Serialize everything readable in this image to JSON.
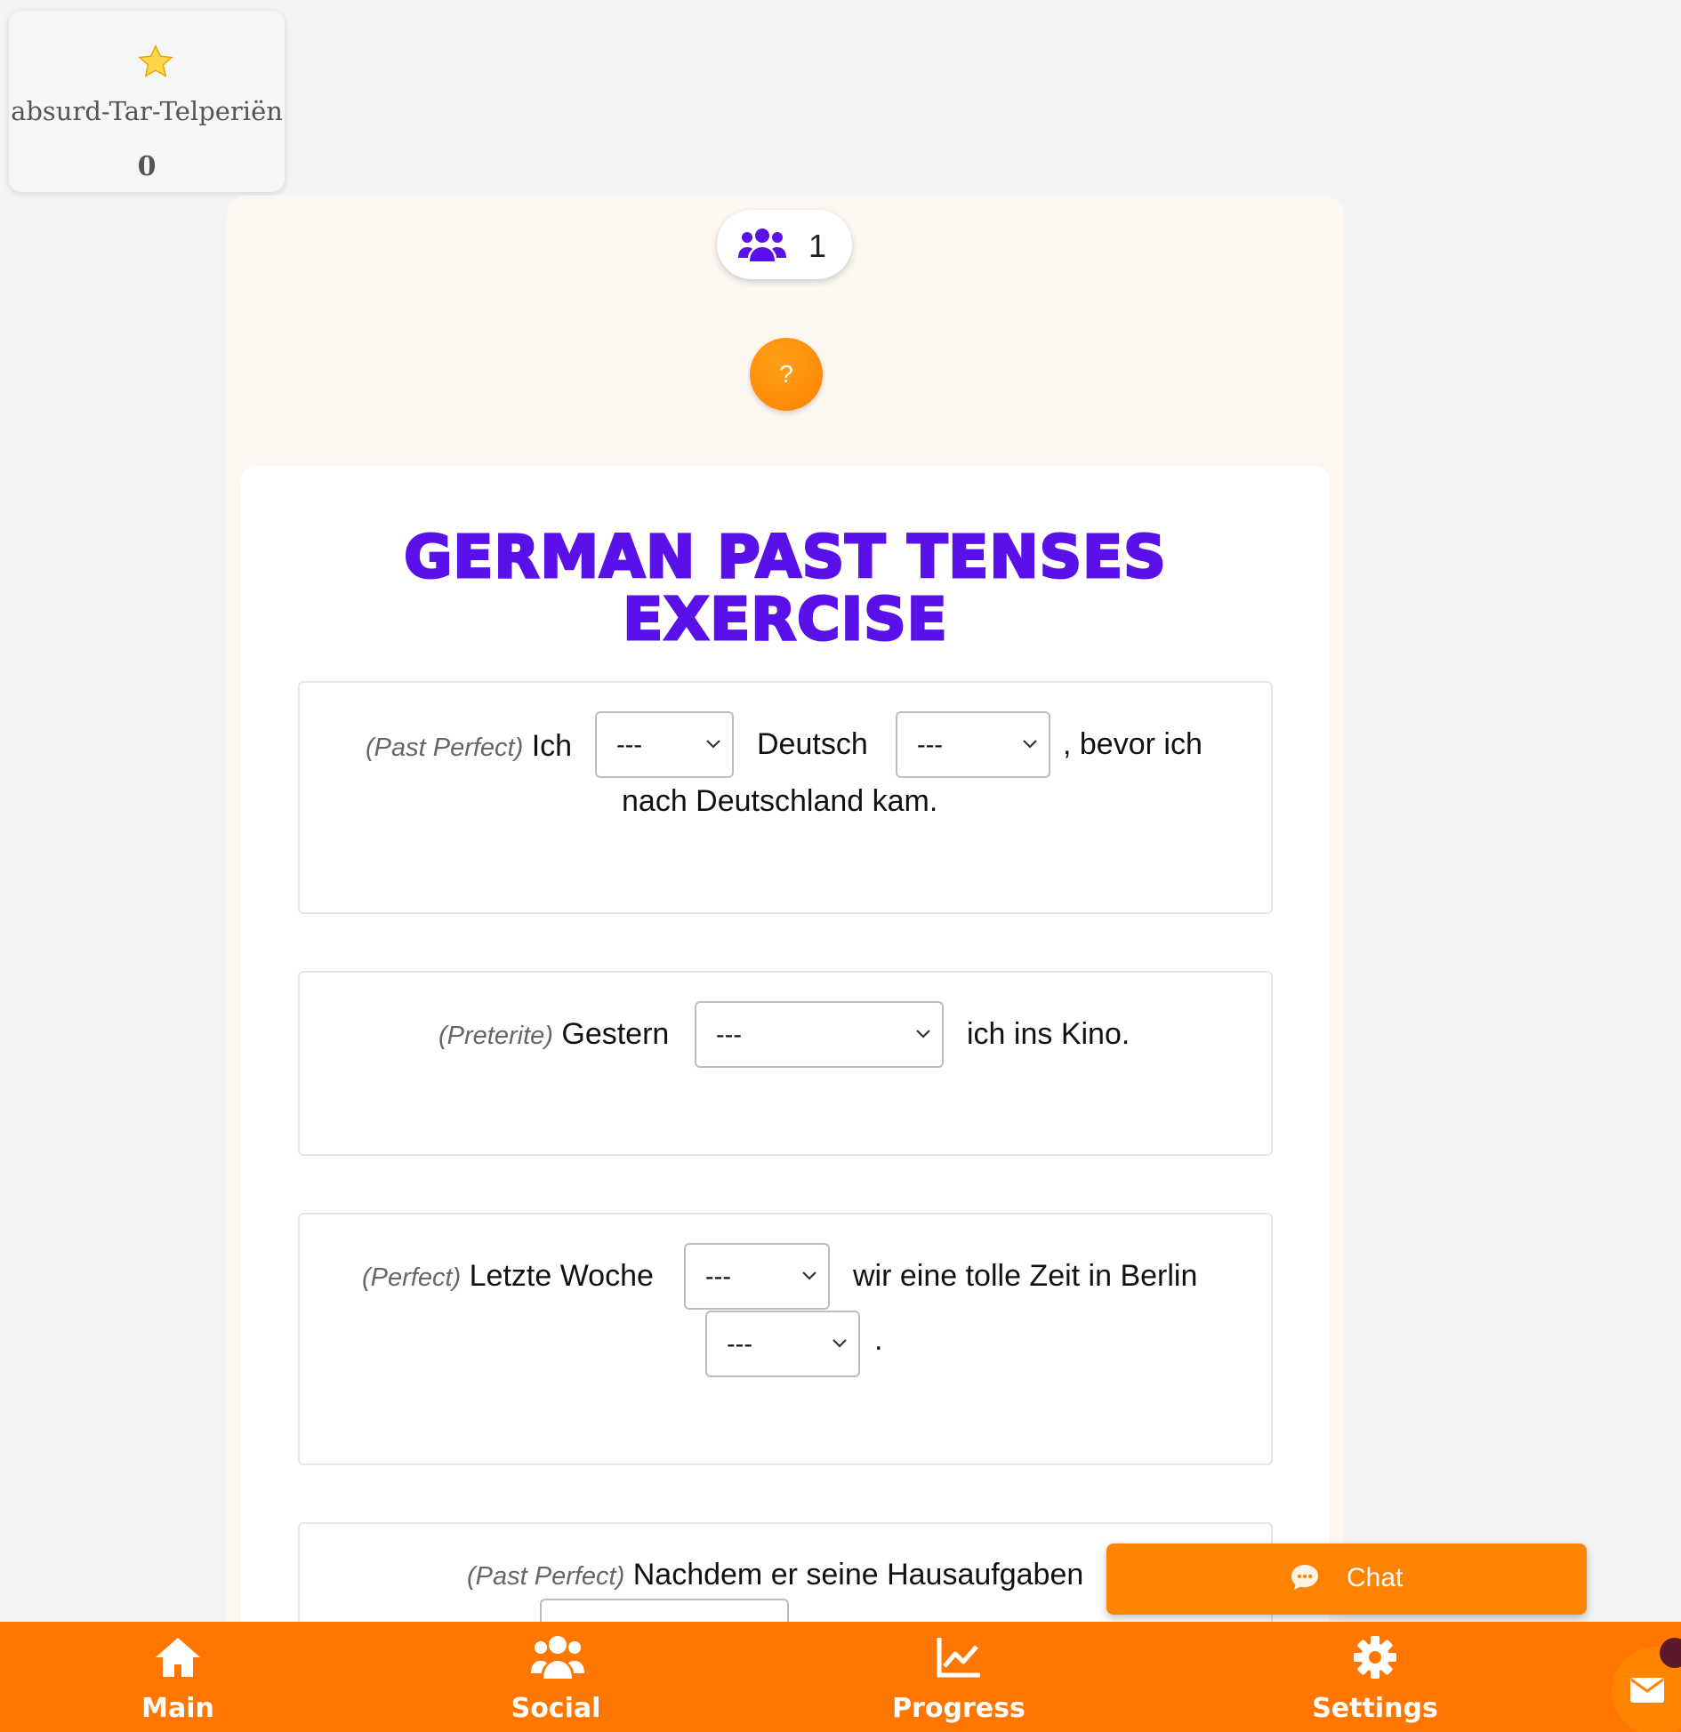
{
  "user": {
    "name": "absurd-Tar-Telperiën",
    "score": "0"
  },
  "players": {
    "count": "1"
  },
  "help": {
    "label": "?"
  },
  "exercise": {
    "title_line1": "German Past Tenses",
    "title_line2": "Exercise",
    "questions": [
      {
        "tense": "(Past Perfect)",
        "parts": [
          "Ich",
          "Deutsch",
          ", bevor ich",
          "nach Deutschland kam."
        ],
        "selects": [
          "---",
          "---"
        ]
      },
      {
        "tense": "(Preterite)",
        "parts": [
          "Gestern",
          "ich ins Kino."
        ],
        "selects": [
          "---"
        ]
      },
      {
        "tense": "(Perfect)",
        "parts": [
          "Letzte Woche",
          "wir eine tolle Zeit in Berlin",
          "."
        ],
        "selects": [
          "---",
          "---"
        ]
      },
      {
        "tense": "(Past Perfect)",
        "parts": [
          "Nachdem er seine Hausaufgaben"
        ],
        "selects": []
      }
    ]
  },
  "chat": {
    "label": "Chat"
  },
  "nav": {
    "items": [
      {
        "label": "Main",
        "icon": "home-icon"
      },
      {
        "label": "Social",
        "icon": "users-icon"
      },
      {
        "label": "Progress",
        "icon": "chart-line-icon"
      },
      {
        "label": "Settings",
        "icon": "gear-icon"
      }
    ]
  },
  "colors": {
    "accent": "#ff7700",
    "title": "#5a10e8",
    "panel": "#fdf7f2"
  }
}
